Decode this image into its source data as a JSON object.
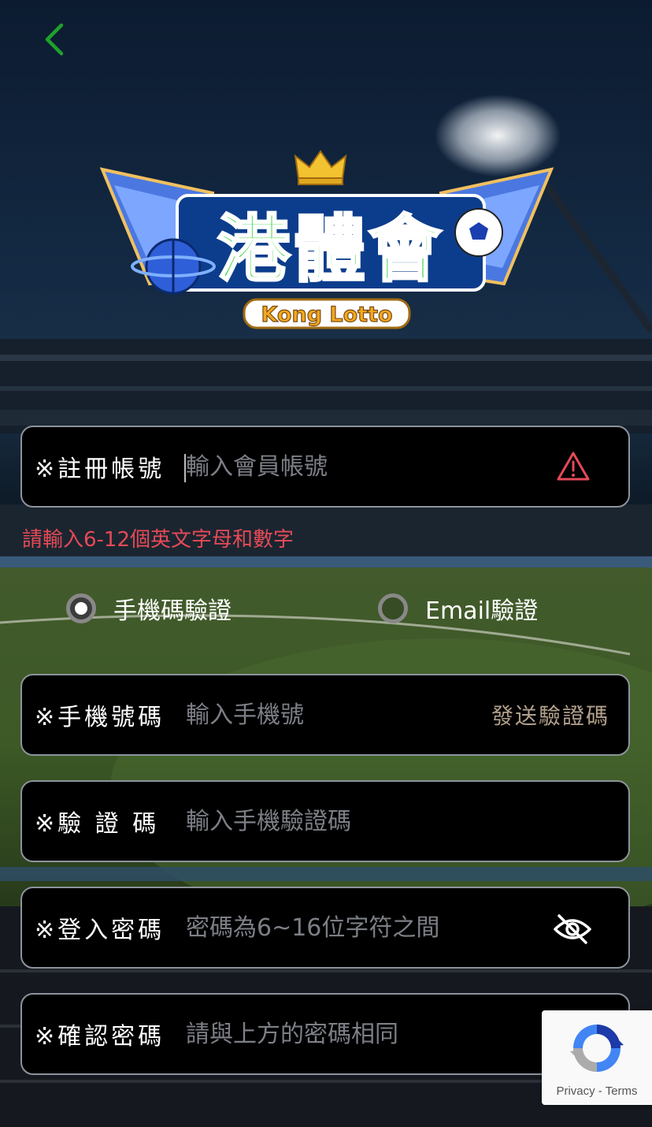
{
  "logo": {
    "title": "港體會",
    "subtitle": "Kong Lotto"
  },
  "form": {
    "account": {
      "label": "※註冊帳號",
      "placeholder": "輸入會員帳號",
      "error": "請輸入6-12個英文字母和數字"
    },
    "verify_method": {
      "options": [
        {
          "label": "手機碼驗證",
          "selected": true
        },
        {
          "label": "Email驗證",
          "selected": false
        }
      ]
    },
    "phone": {
      "label": "※手機號碼",
      "placeholder": "輸入手機號",
      "send_code": "發送驗證碼"
    },
    "code": {
      "label": "※驗 證 碼",
      "placeholder": "輸入手機驗證碼"
    },
    "password": {
      "label": "※登入密碼",
      "placeholder": "密碼為6~16位字符之間"
    },
    "confirm_password": {
      "label": "※確認密碼",
      "placeholder": "請與上方的密碼相同"
    }
  },
  "recaptcha": {
    "privacy": "Privacy",
    "separator": " - ",
    "terms": "Terms"
  },
  "colors": {
    "back_arrow": "#1fa12b",
    "error": "#e54a57",
    "send_code": "#b1a08c",
    "field_border": "#8d939c"
  }
}
